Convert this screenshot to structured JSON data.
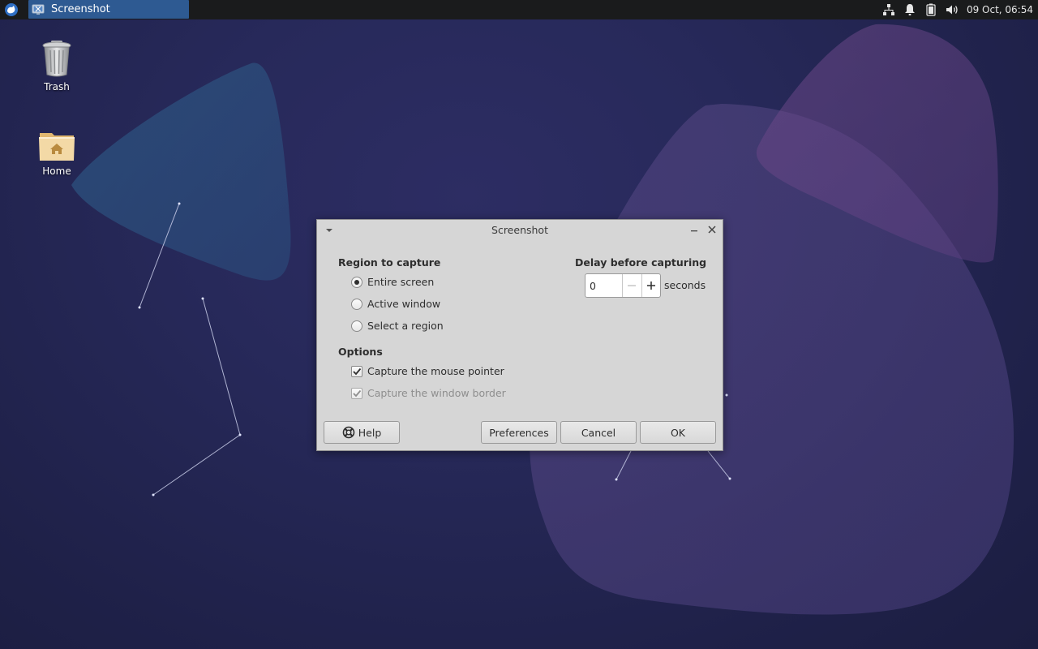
{
  "panel": {
    "taskbar_window_label": "Screenshot",
    "clock": "09 Oct, 06:54",
    "icons": {
      "app_menu": "xfce-mouse-icon",
      "network": "network-wired-icon",
      "notifications": "bell-icon",
      "battery": "battery-icon",
      "volume": "volume-icon"
    }
  },
  "desktop": {
    "icons": [
      {
        "label": "Trash",
        "icon": "trash-icon"
      },
      {
        "label": "Home",
        "icon": "home-folder-icon"
      }
    ]
  },
  "dialog": {
    "title": "Screenshot",
    "region": {
      "heading": "Region to capture",
      "options": [
        {
          "label": "Entire screen",
          "selected": true
        },
        {
          "label": "Active window",
          "selected": false
        },
        {
          "label": "Select a region",
          "selected": false
        }
      ]
    },
    "delay": {
      "heading": "Delay before capturing",
      "value": "0",
      "unit": "seconds"
    },
    "options": {
      "heading": "Options",
      "items": [
        {
          "label": "Capture the mouse pointer",
          "checked": true,
          "enabled": true
        },
        {
          "label": "Capture the window border",
          "checked": true,
          "enabled": false
        }
      ]
    },
    "buttons": {
      "help": "Help",
      "preferences": "Preferences",
      "cancel": "Cancel",
      "ok": "OK"
    }
  },
  "colors": {
    "panel_bg": "#1a1b1c",
    "taskbar_active": "#2e5a92",
    "dialog_bg": "#d6d6d6",
    "desktop_bg": "#27295a"
  }
}
